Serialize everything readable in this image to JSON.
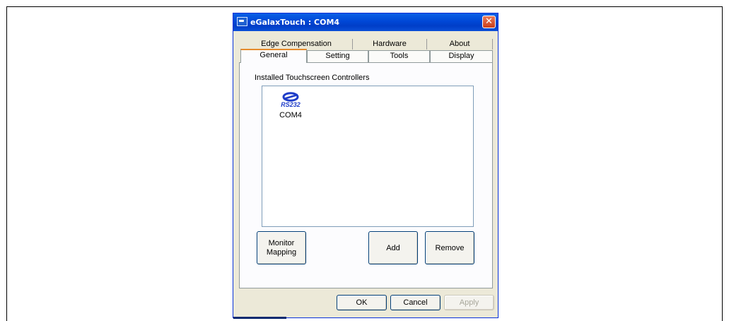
{
  "window": {
    "title": "eGalaxTouch : COM4",
    "close_glyph": "✕"
  },
  "tabs": {
    "back_row": [
      {
        "label": "Edge Compensation"
      },
      {
        "label": "Hardware"
      },
      {
        "label": "About"
      }
    ],
    "front_row": [
      {
        "label": "General",
        "selected": true
      },
      {
        "label": "Setting"
      },
      {
        "label": "Tools"
      },
      {
        "label": "Display"
      }
    ]
  },
  "general": {
    "group_label": "Installed Touchscreen Controllers",
    "devices": [
      {
        "icon": "rs232-icon",
        "icon_text": "RS232",
        "name": "COM4"
      }
    ],
    "buttons": {
      "monitor_mapping": "Monitor\nMapping",
      "add": "Add",
      "remove": "Remove"
    }
  },
  "footer": {
    "ok": "OK",
    "cancel": "Cancel",
    "apply": "Apply"
  },
  "colors": {
    "titlebar": "#0047d6",
    "dialog_bg": "#ece9d8",
    "selected_tab_accent": "#e68b2c",
    "rs232_blue": "#1e3cc8"
  }
}
